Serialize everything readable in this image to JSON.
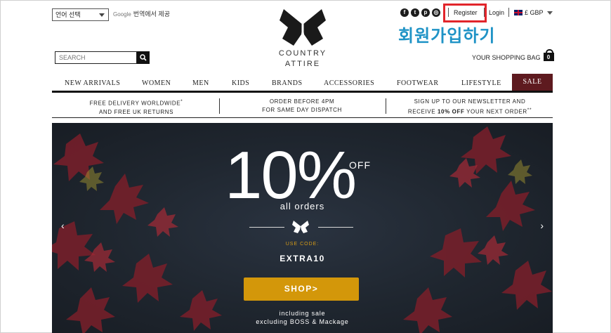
{
  "top_bar": {
    "language_select_value": "언어 선택",
    "google_label": "Google",
    "translate_text": "번역에서 제공"
  },
  "brand": {
    "line1": "COUNTRY",
    "line2": "ATTIRE"
  },
  "social_icons": [
    "facebook-icon",
    "twitter-icon",
    "pinterest-icon",
    "instagram-icon"
  ],
  "account": {
    "register_label": "Register",
    "login_label": "Login",
    "currency_label": "£ GBP"
  },
  "annotation_text": "회원가입하기",
  "search": {
    "placeholder": "SEARCH"
  },
  "bag": {
    "label": "YOUR SHOPPING BAG",
    "count": "0"
  },
  "nav": {
    "items": [
      "NEW ARRIVALS",
      "WOMEN",
      "MEN",
      "KIDS",
      "BRANDS",
      "ACCESSORIES",
      "FOOTWEAR",
      "LIFESTYLE"
    ],
    "sale_label": "SALE"
  },
  "info_strip": {
    "col1_line1": "FREE DELIVERY WORLDWIDE",
    "col1_mark": "*",
    "col1_line2": "AND FREE UK RETURNS",
    "col2_line1": "ORDER BEFORE 4PM",
    "col2_line2": "FOR SAME DAY DISPATCH",
    "col3_line1": "SIGN UP TO OUR NEWSLETTER AND",
    "col3_line2_prefix": "RECEIVE ",
    "col3_bold": "10% OFF",
    "col3_line2_suffix": " YOUR NEXT ORDER",
    "col3_mark": "**"
  },
  "hero": {
    "percent": "10%",
    "off": "OFF",
    "subtitle": "all orders",
    "use_code_label": "USE CODE:",
    "code": "EXTRA10",
    "button_label": "SHOP>",
    "note1": "including sale",
    "note2": "excluding BOSS & Mackage",
    "prev_arrow": "‹",
    "next_arrow": "›"
  },
  "colors": {
    "sale_bg": "#5e1a1f",
    "shop_button": "#d3970a",
    "annotation": "#1f93c6",
    "highlight_box": "#e2252b",
    "use_code": "#d59c18"
  }
}
